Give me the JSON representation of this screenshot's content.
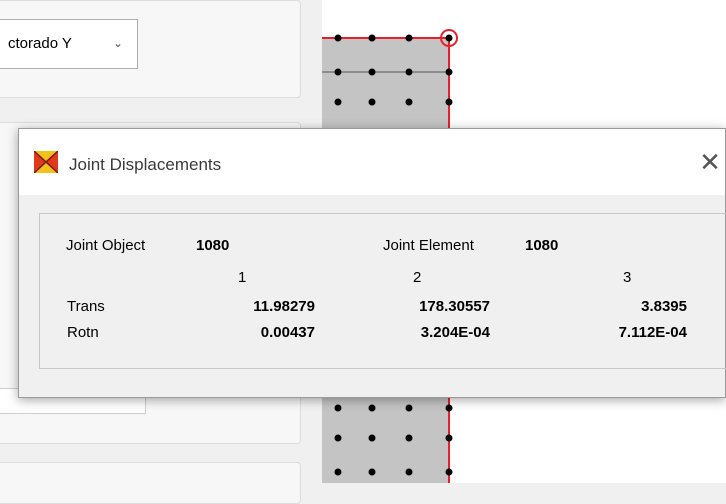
{
  "background_panel": {
    "combo_value": "ctorado Y",
    "combo_arrow": "⌄"
  },
  "dialog": {
    "title": "Joint Displacements",
    "close_glyph": "✕",
    "icon": "sap2000-app-icon",
    "joint_object_label": "Joint  Object",
    "joint_object_value": "1080",
    "joint_element_label": "Joint Element",
    "joint_element_value": "1080",
    "columns": [
      "1",
      "2",
      "3"
    ],
    "rows": [
      {
        "label": "Trans",
        "values": [
          "11.98279",
          "178.30557",
          "3.8395"
        ]
      },
      {
        "label": "Rotn",
        "values": [
          "0.00437",
          "3.204E-04",
          "7.112E-04"
        ]
      }
    ]
  },
  "colors": {
    "selection_red": "#e8202a",
    "shaded_area": "#c4c4c4",
    "node_dot": "#000000"
  }
}
